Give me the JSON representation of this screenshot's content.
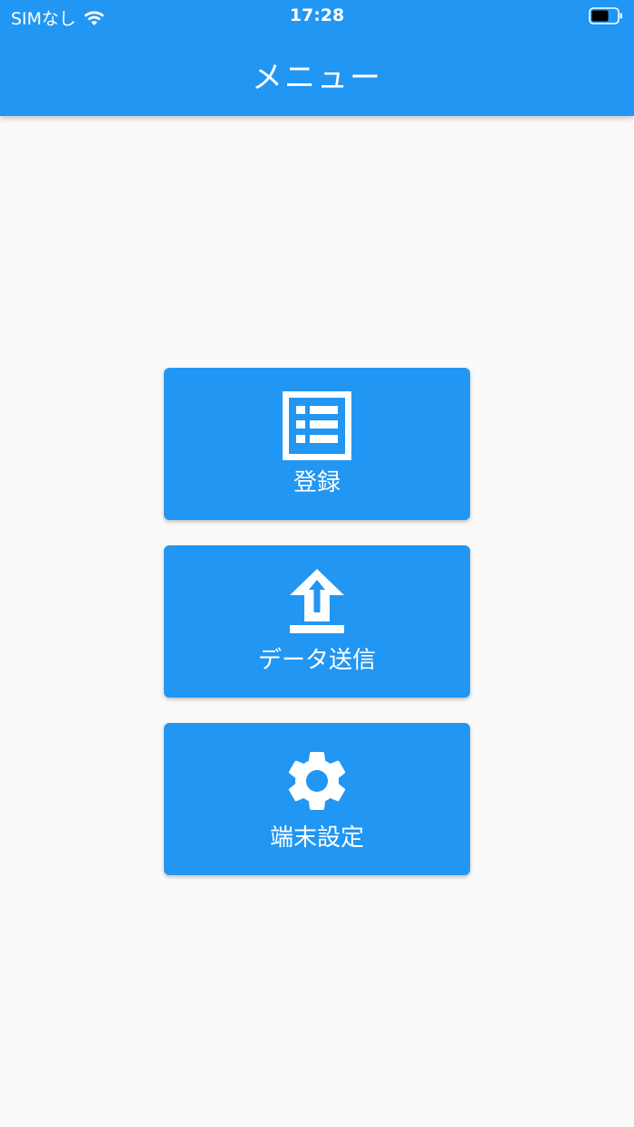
{
  "status_bar": {
    "carrier": "SIMなし",
    "time": "17:28"
  },
  "header": {
    "title": "メニュー"
  },
  "menu": {
    "items": [
      {
        "label": "登録",
        "icon": "list-icon"
      },
      {
        "label": "データ送信",
        "icon": "upload-icon"
      },
      {
        "label": "端末設定",
        "icon": "gear-icon"
      }
    ]
  },
  "colors": {
    "primary": "#2196f3",
    "background": "#fafafa",
    "on_primary": "#ffffff"
  }
}
